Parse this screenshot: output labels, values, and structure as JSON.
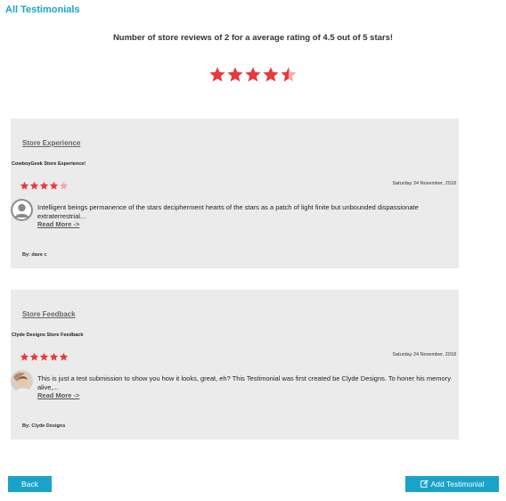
{
  "page": {
    "heading": "All Testimonials",
    "summary": "Number of store reviews of 2 for a average rating of 4.5 out of 5 stars!",
    "average_rating": 4.5,
    "max_rating": 5
  },
  "colors": {
    "accent": "#1aa3c9",
    "star_filled": "#e8393b",
    "star_empty": "#f2a9aa",
    "card_bg": "#ebebeb"
  },
  "testimonials": [
    {
      "title": "Store Experience",
      "subtitle": "CowboyGeek Store Experience!",
      "rating": 4,
      "date": "Saturday 24 November, 2018",
      "avatar_icon": "default-user-avatar-icon",
      "body": "Intelligent beings permanence of the stars decipherment hearts of the stars as a patch of light finite but unbounded dispassionate extraterrestrial...",
      "read_more": "Read More ->",
      "by": "By: dave c"
    },
    {
      "title": "Store Feedback",
      "subtitle": "Clyde Designs Store Feedback",
      "rating": 5,
      "date": "Saturday 24 November, 2018",
      "avatar_icon": "user-photo-avatar",
      "body": "This is just a test submission to show you how it looks, great, eh? This Testimonial was first created be Clyde Designs. To honer his memory alive,...",
      "read_more": "Read More ->",
      "by": "By: Clyde Designs"
    }
  ],
  "buttons": {
    "back": "Back",
    "add": "Add Testimonial",
    "add_icon": "edit-icon"
  }
}
